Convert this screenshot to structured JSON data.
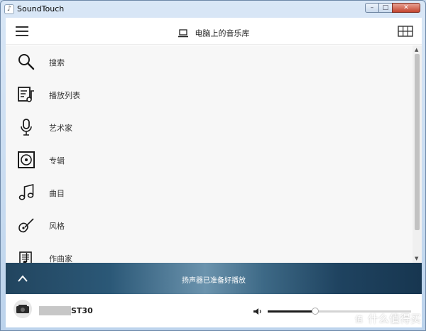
{
  "window": {
    "title": "SoundTouch",
    "app_icon_glyph": "♪",
    "controls": {
      "minimize": "–",
      "maximize": "□",
      "close": "✕"
    }
  },
  "header": {
    "source_title": "电脑上的音乐库",
    "source_icon": "laptop-icon",
    "menu_icon": "hamburger-menu-icon",
    "view_icon": "grid-view-icon"
  },
  "menu": {
    "items": [
      {
        "icon": "search-icon",
        "label": "搜索"
      },
      {
        "icon": "playlist-icon",
        "label": "播放列表"
      },
      {
        "icon": "microphone-icon",
        "label": "艺术家"
      },
      {
        "icon": "album-icon",
        "label": "专辑"
      },
      {
        "icon": "music-note-icon",
        "label": "曲目"
      },
      {
        "icon": "guitar-icon",
        "label": "风格"
      },
      {
        "icon": "composer-icon",
        "label": "作曲家"
      }
    ]
  },
  "now_playing": {
    "status": "扬声器已准备好播放",
    "expand_icon": "chevron-up-icon",
    "colors": {
      "bar_dark": "#1f4360",
      "bar_light": "#6b93ad"
    }
  },
  "speaker": {
    "name": "ST30",
    "volume_percent": 33
  },
  "watermark": {
    "badge": "值",
    "text": "什么值得买"
  }
}
